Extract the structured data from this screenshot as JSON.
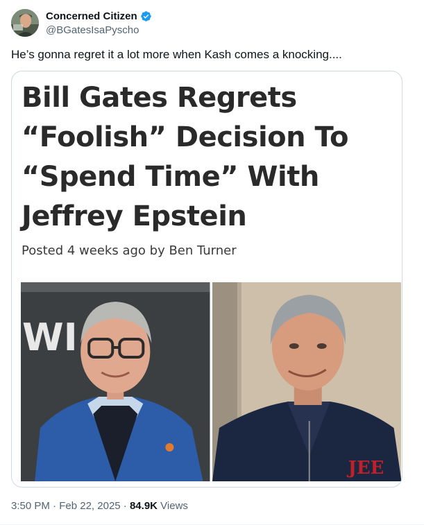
{
  "author": {
    "display_name": "Concerned Citizen",
    "handle": "@BGatesIsaPyscho",
    "verified": true
  },
  "tweet": {
    "text": "He’s gonna regret it a lot more when Kash comes a knocking...."
  },
  "card": {
    "headline": "Bill Gates Regrets “Foolish” Decision To “Spend Time” With Jeffrey Epstein",
    "byline": "Posted 4 weeks ago by Ben Turner",
    "left_photo_sign_text": "WI ILL",
    "right_photo_logo_text": "JEE"
  },
  "meta": {
    "time": "3:50 PM",
    "separator": "·",
    "date": "Feb 22, 2025",
    "views_count": "84.9K",
    "views_label": "Views"
  },
  "colors": {
    "verified_blue": "#1d9bf0",
    "secondary_text": "#536471",
    "card_border": "#cfd9de"
  },
  "icons": [
    "avatar-image",
    "verified-badge-icon"
  ]
}
